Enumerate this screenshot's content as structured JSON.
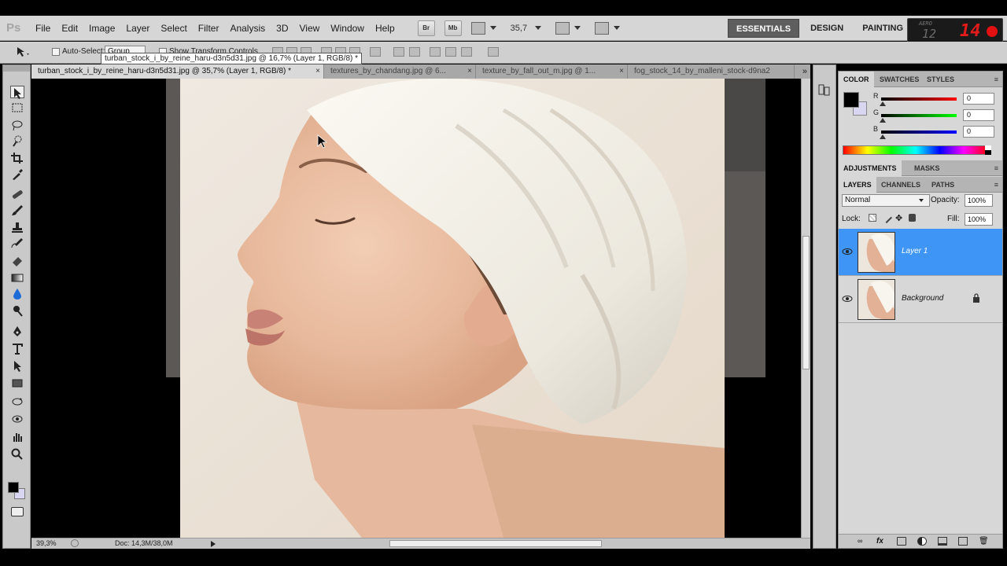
{
  "app": {
    "logo": "Ps"
  },
  "menu": [
    "File",
    "Edit",
    "Image",
    "Layer",
    "Select",
    "Filter",
    "Analysis",
    "3D",
    "View",
    "Window",
    "Help"
  ],
  "menubar": {
    "bridge_label": "Br",
    "mini_bridge_label": "Mb",
    "zoom": "35,7"
  },
  "workspaces": {
    "essentials": "ESSENTIALS",
    "design": "DESIGN",
    "painting": "PAINTING"
  },
  "cslive": {
    "label": "AERO",
    "left_counter": "12",
    "right_counter": "14"
  },
  "options": {
    "auto_select_label": "Auto-Select:",
    "auto_select_value": "Group",
    "show_transform_label": "Show Transform Controls"
  },
  "tooltip": "turban_stock_i_by_reine_haru-d3n5d31.jpg @ 16,7% (Layer 1, RGB/8) *",
  "doc_tabs": [
    {
      "label": "turban_stock_i_by_reine_haru-d3n5d31.jpg @ 35,7% (Layer 1, RGB/8) *",
      "close": "×"
    },
    {
      "label": "textures_by_chandang.jpg @ 6...",
      "close": "×"
    },
    {
      "label": "texture_by_fall_out_m.jpg @ 1...",
      "close": "×"
    },
    {
      "label": "fog_stock_14_by_malleni_stock-d9na2",
      "close": ""
    }
  ],
  "tabs_more": "»",
  "status": {
    "zoom": "39,3%",
    "doc": "Doc: 14,3M/38,0M"
  },
  "color_panel": {
    "tabs": [
      "COLOR",
      "SWATCHES",
      "STYLES"
    ],
    "r": "0",
    "g": "0",
    "b": "0",
    "r_label": "R",
    "g_label": "G",
    "b_label": "B",
    "fg": "#000000",
    "bg": "#d8d6f0"
  },
  "adjust_panel": {
    "tabs": [
      "ADJUSTMENTS",
      "MASKS"
    ]
  },
  "layers_panel": {
    "tabs": [
      "LAYERS",
      "CHANNELS",
      "PATHS"
    ],
    "blend_mode": "Normal",
    "opacity_label": "Opacity:",
    "opacity": "100%",
    "lock_label": "Lock:",
    "fill_label": "Fill:",
    "fill": "100%",
    "layers": [
      {
        "name": "Layer 1",
        "selected": true
      },
      {
        "name": "Background",
        "selected": false,
        "locked": true
      }
    ]
  },
  "colors": {
    "selection": "#3e95f5",
    "ui_bg": "#d6d6d6"
  },
  "icons": [
    "move-icon",
    "marquee-icon",
    "lasso-icon",
    "quick-select-icon",
    "crop-icon",
    "eyedropper-icon",
    "healing-icon",
    "brush-icon",
    "clone-stamp-icon",
    "history-brush-icon",
    "eraser-icon",
    "gradient-icon",
    "blur-icon",
    "dodge-icon",
    "pen-icon",
    "type-icon",
    "path-select-icon",
    "shape-icon",
    "3d-rotate-icon",
    "3d-orbit-icon",
    "hand-icon",
    "zoom-icon"
  ]
}
